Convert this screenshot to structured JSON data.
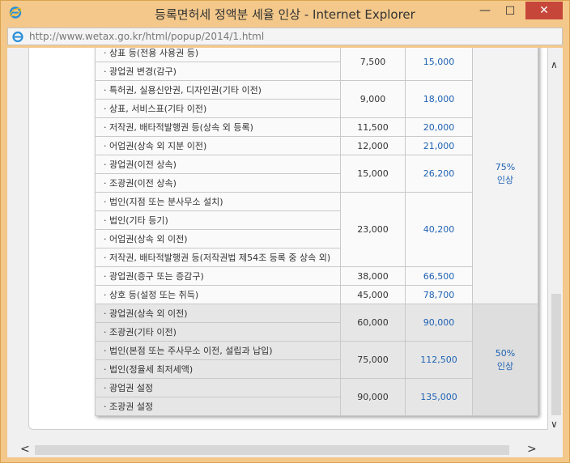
{
  "window": {
    "title": "등록면허세 정액분 세율 인상 - Internet Explorer",
    "minimize": "—",
    "maximize": "☐",
    "close": "✕"
  },
  "address": {
    "url": "http://www.wetax.go.kr/html/popup/2014/1.html"
  },
  "table": {
    "rows": [
      {
        "item": "· 상표 등(전용 사용권 등)",
        "old": "7,500",
        "new": "15,000"
      },
      {
        "item": "· 광업권 변경(감구)"
      },
      {
        "item": "· 특허권, 실용신안권, 디자인권(기타 이전)",
        "old": "9,000",
        "new": "18,000"
      },
      {
        "item": "· 상표, 서비스표(기타 이전)"
      },
      {
        "item": "· 저작권, 배타적발행권 등(상속 외 등록)",
        "old": "11,500",
        "new": "20,000"
      },
      {
        "item": "· 어업권(상속 외 지분 이전)",
        "old": "12,000",
        "new": "21,000"
      },
      {
        "item": "· 광업권(이전 상속)",
        "old": "15,000",
        "new": "26,200"
      },
      {
        "item": "· 조광권(이전 상속)"
      },
      {
        "item": "· 법인(지점 또는 분사무소 설치)",
        "old": "23,000",
        "new": "40,200"
      },
      {
        "item": "· 법인(기타 등기)"
      },
      {
        "item": "· 어업권(상속 외 이전)"
      },
      {
        "item": "· 저작권, 배타적발행권 등(저작권법 제54조 등록 중 상속 외)"
      },
      {
        "item": "· 광업권(증구 또는 증감구)",
        "old": "38,000",
        "new": "66,500"
      },
      {
        "item": "· 상호 등(설정 또는 취득)",
        "old": "45,000",
        "new": "78,700"
      },
      {
        "item": "· 광업권(상속 외 이전)",
        "old": "60,000",
        "new": "90,000"
      },
      {
        "item": "· 조광권(기타 이전)"
      },
      {
        "item": "· 법인(본점 또는 주사무소 이전, 설립과 납입)",
        "old": "75,000",
        "new": "112,500"
      },
      {
        "item": "· 법인(정율세 최저세액)"
      },
      {
        "item": "· 광업권 설정",
        "old": "90,000",
        "new": "135,000"
      },
      {
        "item": "· 조광권 설정"
      }
    ],
    "rate75": [
      "75%",
      "인상"
    ],
    "rate50": [
      "50%",
      "인상"
    ]
  }
}
